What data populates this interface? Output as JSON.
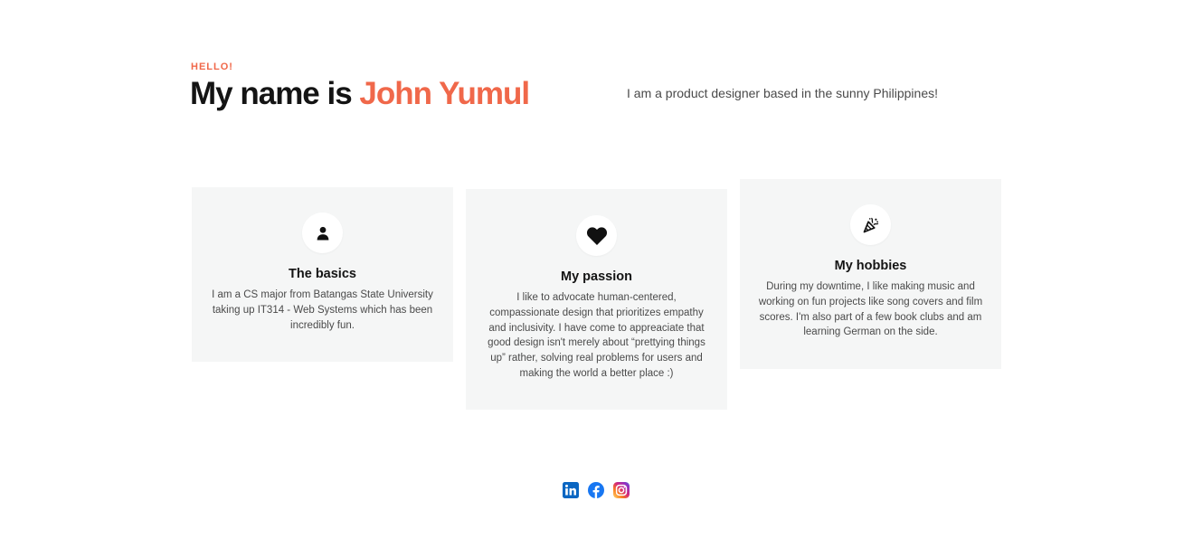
{
  "hero": {
    "eyebrow": "HELLO!",
    "headline_prefix": "My name is ",
    "name": "John Yumul",
    "tagline": "I am a product designer based in the sunny Philippines!"
  },
  "cards": [
    {
      "icon": "person-icon",
      "title": "The basics",
      "body": "I am a CS major from Batangas State University taking up IT314 - Web Systems which has been incredibly fun."
    },
    {
      "icon": "heart-icon",
      "title": "My passion",
      "body": "I like to advocate human-centered, compassionate design that prioritizes empathy and inclusivity. I have come to appreaciate that good design isn't merely about “prettying things up” rather, solving real problems for users and making the world a better place :)"
    },
    {
      "icon": "party-popper-icon",
      "title": "My hobbies",
      "body": "During my downtime, I like making music and working on fun projects like song covers and film scores. I'm also part of a few book clubs and am learning German on the side."
    }
  ],
  "socials": [
    {
      "icon": "linkedin-icon",
      "color": "#0a66c2"
    },
    {
      "icon": "facebook-icon",
      "color": "#1877f2"
    },
    {
      "icon": "instagram-icon",
      "color": "#e1306c"
    }
  ],
  "colors": {
    "accent": "#f0684a",
    "card_bg": "#f5f6f6",
    "heading": "#141414",
    "body_text": "#4a4a4a"
  }
}
